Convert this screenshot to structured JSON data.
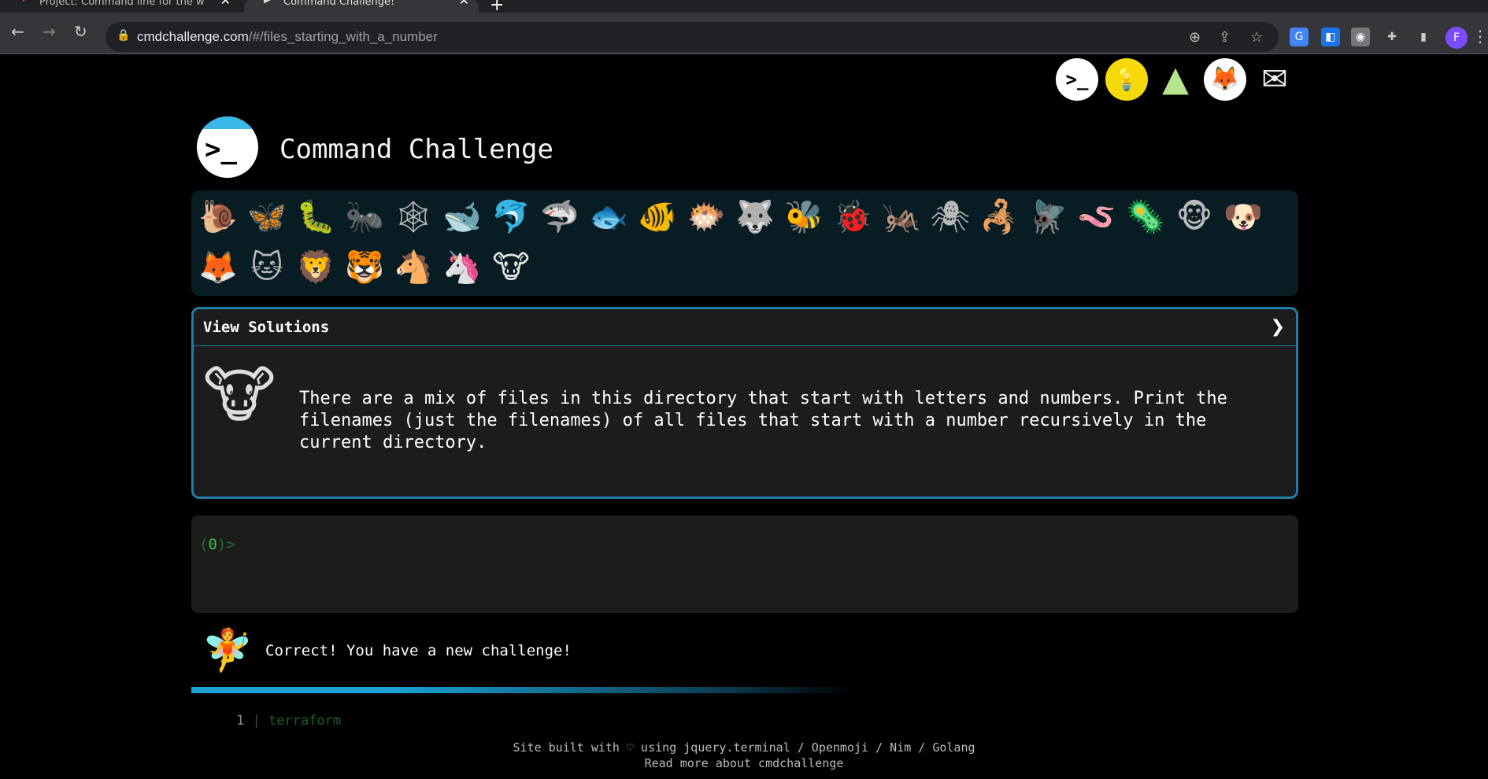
{
  "browser": {
    "tabs": [
      {
        "title": "Project: Command line for the w"
      },
      {
        "title": "Command Challenge!"
      }
    ],
    "new_tab_icon": "+",
    "url_host": "cmdchallenge.com",
    "url_path": "/#/files_starting_with_a_number",
    "avatar_letter": "F"
  },
  "site": {
    "title": "Command Challenge",
    "social_icons": [
      "terminal-icon",
      "lightbulb-icon",
      "tree-icon",
      "gitlab-icon",
      "mail-icon"
    ]
  },
  "animals": [
    "snail",
    "butterfly",
    "caterpillar",
    "ant",
    "spider-web",
    "whale",
    "dolphin",
    "shark",
    "fish",
    "tropical-fish",
    "blowfish",
    "wolf",
    "bee",
    "ladybug",
    "cricket",
    "spider",
    "scorpion",
    "fly",
    "worm",
    "microbe",
    "monkey",
    "dog",
    "fox",
    "cat",
    "lion",
    "tiger",
    "horse",
    "unicorn",
    "cow"
  ],
  "solutions": {
    "label": "View Solutions",
    "description": "There are a mix of files in this directory that start with letters and numbers. Print the filenames (just the filenames) of all files that start with a number recursively in the current directory."
  },
  "terminal": {
    "prompt_open": "(",
    "prompt_count": "0",
    "prompt_close": ")>"
  },
  "result": {
    "message": "Correct! You have a new challenge!"
  },
  "progress": {
    "fraction": 0.47
  },
  "history": {
    "line_number": "1",
    "separator": "|",
    "command": "terraform"
  },
  "footer": {
    "line1": "Site built with ♡ using jquery.terminal / Openmoji / Nim / Golang",
    "line2": "Read more about cmdchallenge"
  }
}
